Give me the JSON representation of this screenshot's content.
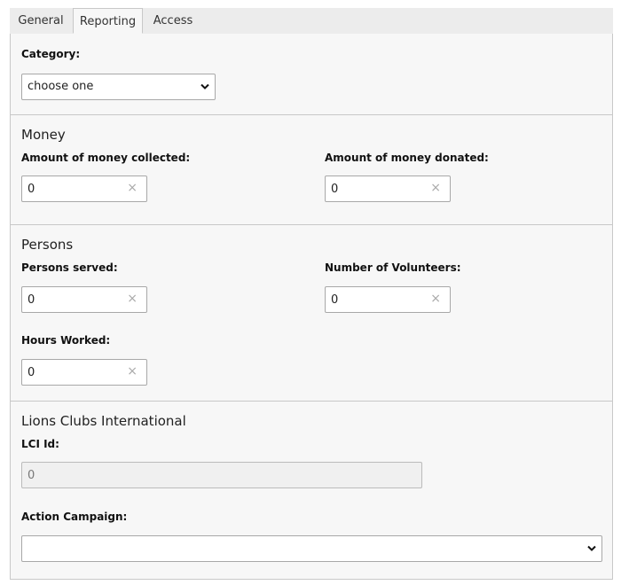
{
  "tabs": [
    {
      "label": "General"
    },
    {
      "label": "Reporting"
    },
    {
      "label": "Access"
    }
  ],
  "category": {
    "label": "Category:",
    "value": "choose one"
  },
  "money": {
    "heading": "Money",
    "collected_label": "Amount of money collected:",
    "collected_value": "0",
    "donated_label": "Amount of money donated:",
    "donated_value": "0"
  },
  "persons": {
    "heading": "Persons",
    "served_label": "Persons served:",
    "served_value": "0",
    "volunteers_label": "Number of Volunteers:",
    "volunteers_value": "0",
    "hours_label": "Hours Worked:",
    "hours_value": "0"
  },
  "lci": {
    "heading": "Lions Clubs International",
    "id_label": "LCI Id:",
    "id_value": "0",
    "campaign_label": "Action Campaign:",
    "campaign_value": ""
  },
  "icons": {
    "clear": "×"
  }
}
